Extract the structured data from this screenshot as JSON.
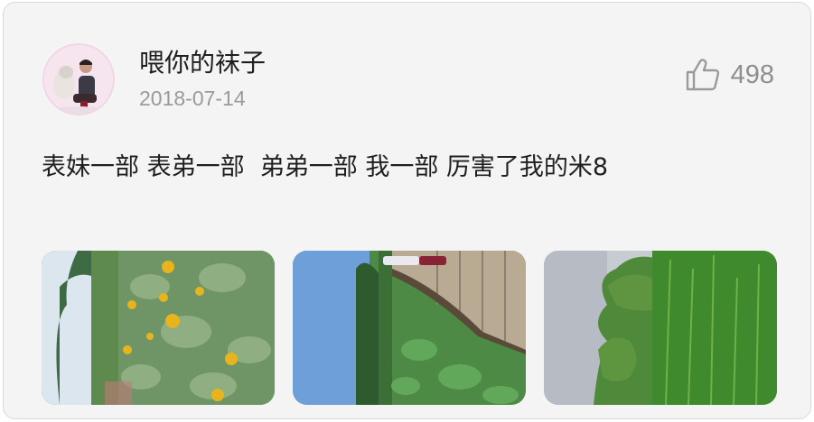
{
  "post": {
    "user": {
      "name": "喂你的袜子",
      "date": "2018-07-14",
      "avatar": "user-avatar-photo"
    },
    "likes": {
      "icon": "thumbs-up-icon",
      "count": "498"
    },
    "text": "表妹一部 表弟一部  弟弟一部 我一部 厉害了我的米8",
    "photos": [
      {
        "subject": "sunflower-field-photo"
      },
      {
        "subject": "wooden-boardwalk-garden-photo"
      },
      {
        "subject": "trees-and-grass-photo"
      }
    ]
  },
  "colors": {
    "card_bg": "#f4f4f4",
    "name": "#1f1f1f",
    "muted": "#9a9a9a",
    "like": "#8e8e8e"
  }
}
